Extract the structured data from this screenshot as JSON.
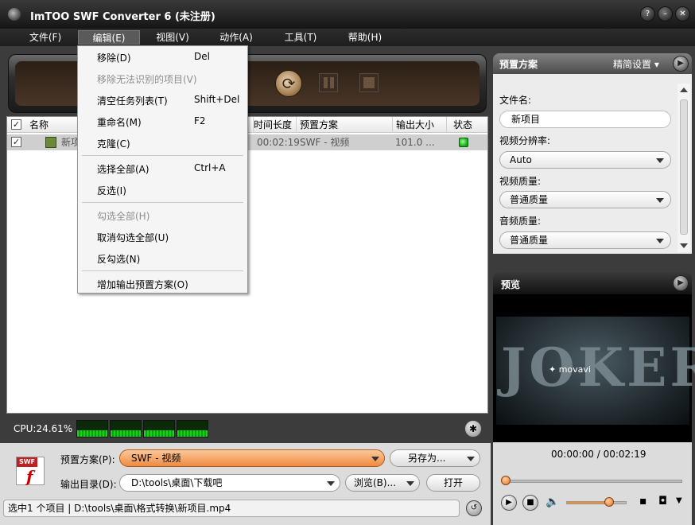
{
  "window": {
    "title": "ImTOO SWF Converter 6 (未注册)",
    "buttons": {
      "help": "?",
      "minimize": "–",
      "maximize": "□",
      "close": "✕"
    }
  },
  "menubar": [
    "文件(F)",
    "编辑(E)",
    "视图(V)",
    "动作(A)",
    "工具(T)",
    "帮助(H)"
  ],
  "edit_menu": {
    "items": [
      {
        "label": "移除(D)",
        "shortcut": "Del",
        "enabled": true
      },
      {
        "label": "移除无法识别的项目(V)",
        "shortcut": "",
        "enabled": false
      },
      {
        "label": "清空任务列表(T)",
        "shortcut": "Shift+Del",
        "enabled": true
      },
      {
        "label": "重命名(M)",
        "shortcut": "F2",
        "enabled": true
      },
      {
        "label": "克隆(C)",
        "shortcut": "",
        "enabled": true
      },
      {
        "label": "选择全部(A)",
        "shortcut": "Ctrl+A",
        "enabled": true
      },
      {
        "label": "反选(I)",
        "shortcut": "",
        "enabled": true
      },
      {
        "label": "勾选全部(H)",
        "shortcut": "",
        "enabled": false
      },
      {
        "label": "取消勾选全部(U)",
        "shortcut": "",
        "enabled": true
      },
      {
        "label": "反勾选(N)",
        "shortcut": "",
        "enabled": true
      },
      {
        "label": "增加输出预置方案(O)",
        "shortcut": "",
        "enabled": true
      }
    ]
  },
  "file_list": {
    "columns": {
      "name": "名称",
      "duration": "时间长度",
      "preset": "预置方案",
      "output_size": "输出大小",
      "status": "状态"
    },
    "rows": [
      {
        "checked": true,
        "name": "新项",
        "duration": "00:02:19",
        "preset": "SWF - 视频",
        "output_size": "101.0 ...",
        "status_color": "#22bb22"
      }
    ]
  },
  "cpu": {
    "label": "CPU:24.61%"
  },
  "settings": {
    "preset_label": "预置方案(P):",
    "preset_value": "SWF - 视频",
    "save_as_label": "另存为...",
    "output_dir_label": "输出目录(D):",
    "output_dir_value": "D:\\tools\\桌面\\下载吧",
    "browse_label": "浏览(B)...",
    "open_label": "打开",
    "swf_badge": "SWF"
  },
  "status_bar": {
    "text": "选中1 个项目 | D:\\tools\\桌面\\格式转换\\新项目.mp4"
  },
  "right_panel": {
    "title": "预置方案",
    "simplify_label": "精简设置",
    "filename_label": "文件名:",
    "filename_value": "新项目",
    "resolution_label": "视频分辨率:",
    "resolution_value": "Auto",
    "video_quality_label": "视频质量:",
    "video_quality_value": "普通质量",
    "audio_quality_label": "音频质量:",
    "audio_quality_value": "普通质量"
  },
  "preview": {
    "title": "预览",
    "video_title": "JOKER",
    "watermark": "movavi",
    "time": "00:00:00 / 00:02:19",
    "seek_position": 0,
    "volume_level": 0.7
  },
  "colors": {
    "accent": "#f08a40",
    "titlebar": "#1e1e1e",
    "status_ok": "#22bb22"
  }
}
